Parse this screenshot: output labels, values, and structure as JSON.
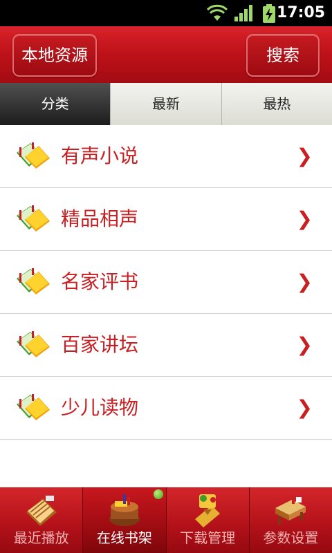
{
  "status_bar": {
    "time": "17:05",
    "icons": [
      "wifi-icon",
      "signal-icon",
      "battery-charging-icon"
    ]
  },
  "header": {
    "left_button": "本地资源",
    "right_button": "搜索"
  },
  "tabs": [
    {
      "label": "分类",
      "active": true
    },
    {
      "label": "最新",
      "active": false
    },
    {
      "label": "最热",
      "active": false
    }
  ],
  "categories": [
    {
      "label": "有声小说",
      "icon": "book-icon",
      "chevron": "❯"
    },
    {
      "label": "精品相声",
      "icon": "book-icon",
      "chevron": "❯"
    },
    {
      "label": "名家评书",
      "icon": "book-icon",
      "chevron": "❯"
    },
    {
      "label": "百家讲坛",
      "icon": "book-icon",
      "chevron": "❯"
    },
    {
      "label": "少儿读物",
      "icon": "book-icon",
      "chevron": "❯"
    }
  ],
  "bottom_nav": [
    {
      "label": "最近播放",
      "icon": "recent-books-icon",
      "active": false
    },
    {
      "label": "在线书架",
      "icon": "bookshelf-icon",
      "active": true
    },
    {
      "label": "下载管理",
      "icon": "download-scroll-icon",
      "active": false
    },
    {
      "label": "参数设置",
      "icon": "settings-desk-icon",
      "active": false
    }
  ],
  "colors": {
    "brand_red": "#c0121a",
    "label_red": "#c81f22",
    "active_tab": "#2e2e2e"
  }
}
